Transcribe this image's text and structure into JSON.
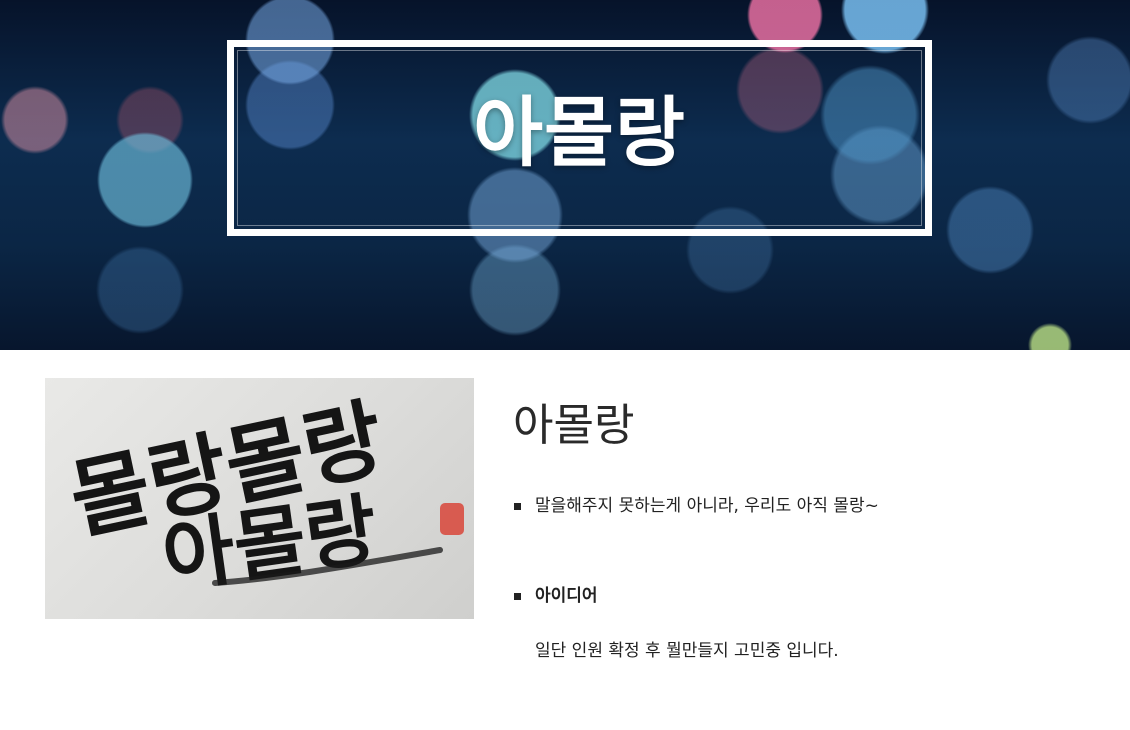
{
  "hero": {
    "title": "아몰랑"
  },
  "content": {
    "photo": {
      "alt": "몰랑몰랑 아몰랑",
      "calligraphy_line1": "몰랑몰랑",
      "calligraphy_line2": "아몰랑"
    },
    "title": "아몰랑",
    "bullets": [
      {
        "text": "말을해주지 못하는게 아니라, 우리도 아직 몰랑~"
      },
      {
        "text": "아이디어"
      }
    ],
    "description": "일단 인원 확정 후 뭘만들지 고민중 입니다."
  }
}
